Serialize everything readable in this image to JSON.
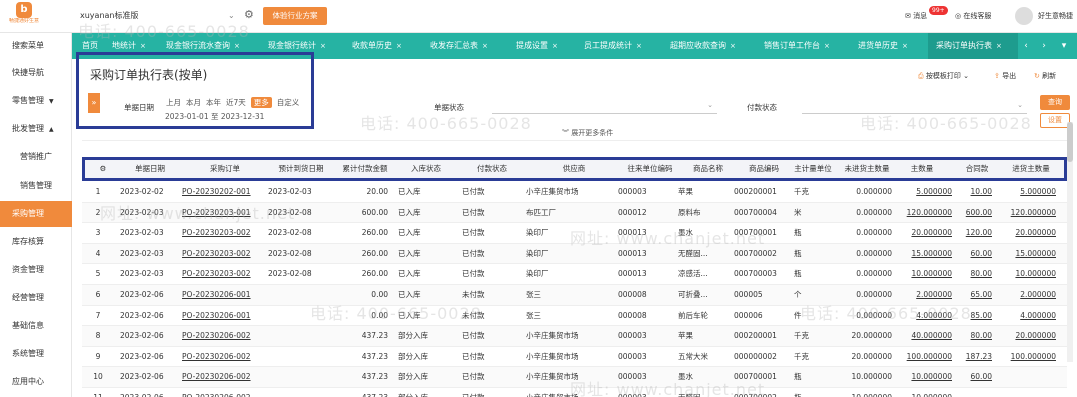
{
  "app": {
    "logo_text": "畅捷通好生意",
    "logo_mark": "b"
  },
  "header": {
    "account": "xuyanan标准版",
    "plan_button": "体验行业方案",
    "messages": "消息",
    "messages_badge": "99+",
    "online_service": "在线客服",
    "user": "好生意畅捷"
  },
  "sidebar": {
    "items": [
      "搜索菜单",
      "快捷导航",
      "零售管理",
      "批发管理",
      "营销推广",
      "销售管理",
      "采购管理",
      "库存核算",
      "资金管理",
      "经营管理",
      "基础信息",
      "系统管理",
      "应用中心"
    ]
  },
  "tabs": [
    "首页",
    "地统计",
    "现金银行流水查询",
    "现金银行统计",
    "收款单历史",
    "收发存汇总表",
    "提成设置",
    "员工提成统计",
    "超期应收款查询",
    "销售订单工作台",
    "进货单历史",
    "采购订单执行表"
  ],
  "page": {
    "title": "采购订单执行表(按单)",
    "print": "按模板打印",
    "export": "导出",
    "refresh": "刷新"
  },
  "filters": {
    "date_label": "单据日期",
    "ranges": [
      "上月",
      "本月",
      "本年",
      "近7天",
      "更多",
      "自定义"
    ],
    "selected_range": "更多",
    "date_range": "2023-01-01 至 2023-12-31",
    "status_label": "单据状态",
    "pay_label": "付款状态",
    "query": "查询",
    "reset": "设置",
    "expand": "展开更多条件"
  },
  "table": {
    "headers": [
      "单据日期",
      "采购订单",
      "预计到货日期",
      "累计付款金额",
      "入库状态",
      "付款状态",
      "供应商",
      "往来单位编码",
      "商品名称",
      "商品编码",
      "主计量单位",
      "未进货主数量",
      "主数量",
      "合同款",
      "进货主数量"
    ],
    "rows": [
      [
        "1",
        "2023-02-02",
        "PO-20230202-001",
        "2023-02-03",
        "20.00",
        "已入库",
        "已付款",
        "小辛庄集贸市场",
        "000003",
        "苹果",
        "000200001",
        "千克",
        "0.000000",
        "5.000000",
        "10.00",
        "5.000000"
      ],
      [
        "2",
        "2023-02-03",
        "PO-20230203-001",
        "2023-02-08",
        "600.00",
        "已入库",
        "已付款",
        "布匹工厂",
        "000012",
        "原料布",
        "000700004",
        "米",
        "0.000000",
        "120.000000",
        "600.00",
        "120.000000"
      ],
      [
        "3",
        "2023-02-03",
        "PO-20230203-002",
        "2023-02-08",
        "260.00",
        "已入库",
        "已付款",
        "染印厂",
        "000013",
        "墨水",
        "000700001",
        "瓶",
        "0.000000",
        "20.000000",
        "120.00",
        "20.000000"
      ],
      [
        "4",
        "2023-02-03",
        "PO-20230203-002",
        "2023-02-08",
        "260.00",
        "已入库",
        "已付款",
        "染印厂",
        "000013",
        "无醛固...",
        "000700002",
        "瓶",
        "0.000000",
        "15.000000",
        "60.00",
        "15.000000"
      ],
      [
        "5",
        "2023-02-03",
        "PO-20230203-002",
        "2023-02-08",
        "260.00",
        "已入库",
        "已付款",
        "染印厂",
        "000013",
        "凉感活...",
        "000700003",
        "瓶",
        "0.000000",
        "10.000000",
        "80.00",
        "10.000000"
      ],
      [
        "6",
        "2023-02-06",
        "PO-20230206-001",
        "",
        "0.00",
        "已入库",
        "未付款",
        "张三",
        "000008",
        "可折叠...",
        "000005",
        "个",
        "0.000000",
        "2.000000",
        "65.00",
        "2.000000"
      ],
      [
        "7",
        "2023-02-06",
        "PO-20230206-001",
        "",
        "0.00",
        "已入库",
        "未付款",
        "张三",
        "000008",
        "前后车轮",
        "000006",
        "件",
        "0.000000",
        "4.000000",
        "85.00",
        "4.000000"
      ],
      [
        "8",
        "2023-02-06",
        "PO-20230206-002",
        "",
        "437.23",
        "部分入库",
        "已付款",
        "小辛庄集贸市场",
        "000003",
        "苹果",
        "000200001",
        "千克",
        "20.000000",
        "40.000000",
        "80.00",
        "20.000000"
      ],
      [
        "9",
        "2023-02-06",
        "PO-20230206-002",
        "",
        "437.23",
        "部分入库",
        "已付款",
        "小辛庄集贸市场",
        "000003",
        "五常大米",
        "000000002",
        "千克",
        "20.000000",
        "100.000000",
        "187.23",
        "100.000000"
      ],
      [
        "10",
        "2023-02-06",
        "PO-20230206-002",
        "",
        "437.23",
        "部分入库",
        "已付款",
        "小辛庄集贸市场",
        "000003",
        "墨水",
        "000700001",
        "瓶",
        "10.000000",
        "10.000000",
        "60.00",
        ""
      ],
      [
        "11",
        "2023-02-06",
        "PO-20230206-002",
        "",
        "437.23",
        "部分入库",
        "已付款",
        "小辛庄集贸市场",
        "000003",
        "无醛固",
        "000700002",
        "瓶",
        "10.000000",
        "10.000000",
        "",
        ""
      ]
    ]
  },
  "watermark": [
    "电话: 400-665-0028",
    "网址: www.chanjet.net"
  ]
}
